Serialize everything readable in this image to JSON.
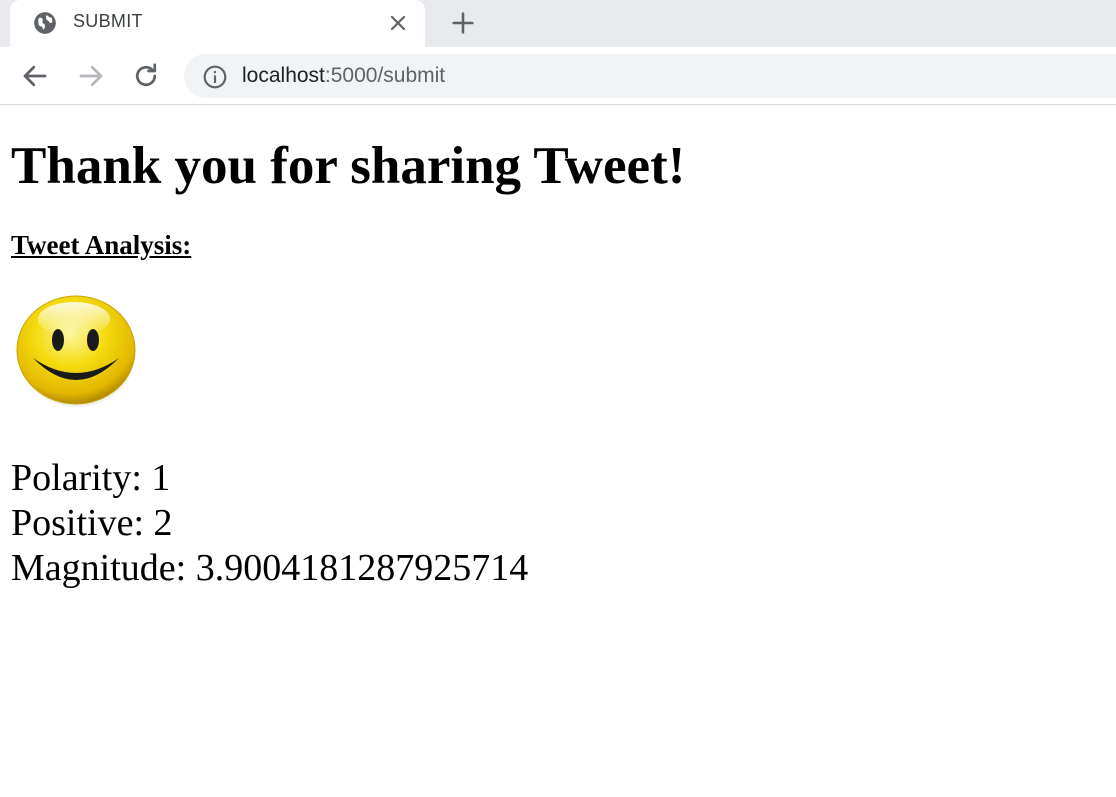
{
  "browser": {
    "tab_title": "SUBMIT",
    "url_host": "localhost",
    "url_rest": ":5000/submit"
  },
  "page": {
    "heading": "Thank you for sharing Tweet!",
    "subheading": "Tweet Analysis:",
    "sentiment_icon": "smiley-face-icon",
    "metrics": [
      {
        "label": "Polarity:",
        "value": "1"
      },
      {
        "label": "Positive:",
        "value": "2"
      },
      {
        "label": "Magnitude:",
        "value": "3.9004181287925714"
      }
    ]
  },
  "colors": {
    "smiley_yellow": "#f2d600",
    "tabstrip": "#e8eaed",
    "omnibox": "#f1f3f4"
  }
}
